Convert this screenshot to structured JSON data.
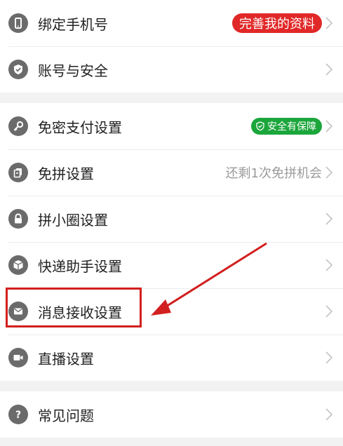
{
  "groups": [
    {
      "items": [
        {
          "label": "绑定手机号",
          "icon": "phone-icon",
          "badge": "完善我的资料"
        },
        {
          "label": "账号与安全",
          "icon": "shield-check-icon"
        }
      ]
    },
    {
      "items": [
        {
          "label": "免密支付设置",
          "icon": "key-icon",
          "badge": "安全有保障",
          "badge_icon": "shield-check-icon"
        },
        {
          "label": "免拼设置",
          "icon": "copy-icon",
          "hint": "还剩1次免拼机会"
        },
        {
          "label": "拼小圈设置",
          "icon": "lock-icon"
        },
        {
          "label": "快递助手设置",
          "icon": "package-icon"
        },
        {
          "label": "消息接收设置",
          "icon": "mail-icon"
        },
        {
          "label": "直播设置",
          "icon": "video-camera-icon"
        }
      ]
    },
    {
      "items": [
        {
          "label": "常见问题",
          "icon": "question-icon"
        }
      ]
    }
  ],
  "colors": {
    "badge_red": "#e12828",
    "badge_green": "#1ba63b",
    "annotation": "#d21f1f",
    "icon_bg": "#6b6b6b"
  }
}
